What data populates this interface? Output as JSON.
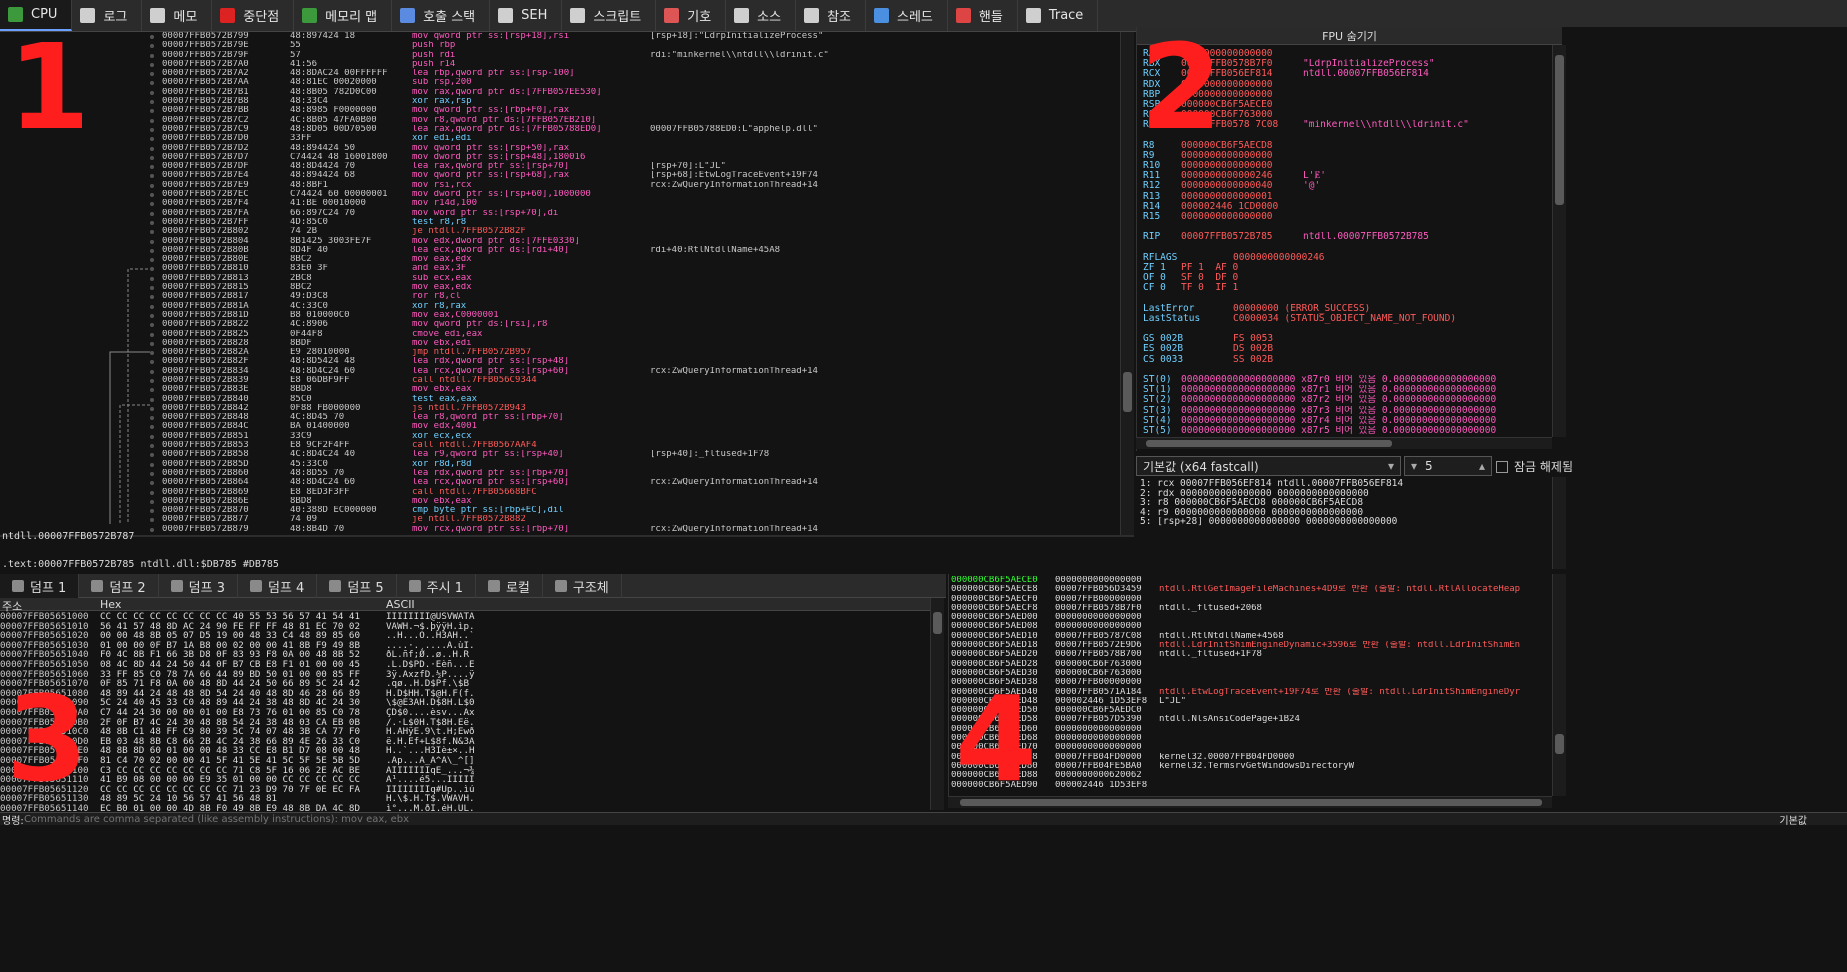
{
  "tabs": [
    {
      "label": "CPU",
      "icon": "cpu-icon",
      "color": "#3c9a3c"
    },
    {
      "label": "로그",
      "icon": "log-icon",
      "color": "#cfcfcf"
    },
    {
      "label": "메모",
      "icon": "notes-icon",
      "color": "#cfcfcf"
    },
    {
      "label": "중단점",
      "icon": "breakpoint-icon",
      "color": "#d22"
    },
    {
      "label": "메모리 맵",
      "icon": "memory-map-icon",
      "color": "#3c9a3c"
    },
    {
      "label": "호출 스택",
      "icon": "call-stack-icon",
      "color": "#5b8be0"
    },
    {
      "label": "SEH",
      "icon": "seh-icon",
      "color": "#cfcfcf"
    },
    {
      "label": "스크립트",
      "icon": "script-icon",
      "color": "#cfcfcf"
    },
    {
      "label": "기호",
      "icon": "symbols-icon",
      "color": "#d55"
    },
    {
      "label": "소스",
      "icon": "source-icon",
      "color": "#cfcfcf"
    },
    {
      "label": "참조",
      "icon": "references-icon",
      "color": "#cfcfcf"
    },
    {
      "label": "스레드",
      "icon": "threads-icon",
      "color": "#4a8fe0"
    },
    {
      "label": "핸들",
      "icon": "handles-icon",
      "color": "#d44"
    },
    {
      "label": "Trace",
      "icon": "trace-icon",
      "color": "#cfcfcf"
    }
  ],
  "disasm": [
    [
      "00007FFB0572B799",
      "48:897424 18",
      "mov qword ptr ss:[rsp+18],rsi",
      "[rsp+18]:\"LdrpInitializeProcess\""
    ],
    [
      "00007FFB0572B79E",
      "55",
      "push rbp",
      ""
    ],
    [
      "00007FFB0572B79F",
      "57",
      "push rdi",
      "rdi:\"minkernel\\\\ntdll\\\\ldrinit.c\""
    ],
    [
      "00007FFB0572B7A0",
      "41:56",
      "push r14",
      ""
    ],
    [
      "00007FFB0572B7A2",
      "48:8DAC24 00FFFFFF",
      "lea rbp,qword ptr ss:[rsp-100]",
      ""
    ],
    [
      "00007FFB0572B7AA",
      "48:81EC 00020000",
      "sub rsp,200",
      ""
    ],
    [
      "00007FFB0572B7B1",
      "48:8B05 782D0C00",
      "mov rax,qword ptr ds:[7FFB057EE530]",
      ""
    ],
    [
      "00007FFB0572B7B8",
      "48:33C4",
      "xor rax,rsp",
      ""
    ],
    [
      "00007FFB0572B7BB",
      "48:8985 F0000000",
      "mov qword ptr ss:[rbp+F0],rax",
      ""
    ],
    [
      "00007FFB0572B7C2",
      "4C:8B05 47FA0B00",
      "mov r8,qword ptr ds:[7FFB057EB210]",
      ""
    ],
    [
      "00007FFB0572B7C9",
      "48:8D05 00D70500",
      "lea rax,qword ptr ds:[7FFB05788ED0]",
      "00007FFB05788ED0:L\"apphelp.dll\""
    ],
    [
      "00007FFB0572B7D0",
      "33FF",
      "xor edi,edi",
      ""
    ],
    [
      "00007FFB0572B7D2",
      "48:894424 50",
      "mov qword ptr ss:[rsp+50],rax",
      ""
    ],
    [
      "00007FFB0572B7D7",
      "C74424 48 16001800",
      "mov dword ptr ss:[rsp+48],180016",
      ""
    ],
    [
      "00007FFB0572B7DF",
      "48:8D4424 70",
      "lea rax,qword ptr ss:[rsp+70]",
      "[rsp+70]:L\"JL\""
    ],
    [
      "00007FFB0572B7E4",
      "48:894424 68",
      "mov qword ptr ss:[rsp+68],rax",
      "[rsp+68]:EtwLogTraceEvent+19F74"
    ],
    [
      "00007FFB0572B7E9",
      "48:8BF1",
      "mov rsi,rcx",
      "rcx:ZwQueryInformationThread+14"
    ],
    [
      "00007FFB0572B7EC",
      "C74424 60 00000001",
      "mov dword ptr ss:[rsp+60],1000000",
      ""
    ],
    [
      "00007FFB0572B7F4",
      "41:BE 00010000",
      "mov r14d,100",
      ""
    ],
    [
      "00007FFB0572B7FA",
      "66:897C24 70",
      "mov word ptr ss:[rsp+70],di",
      ""
    ],
    [
      "00007FFB0572B7FF",
      "4D:85C0",
      "test r8,r8",
      ""
    ],
    [
      "00007FFB0572B802",
      "74 2B",
      "je ntdll.7FFB0572B82F",
      ""
    ],
    [
      "00007FFB0572B804",
      "8B1425 3003FE7F",
      "mov edx,dword ptr ds:[7FFE0330]",
      ""
    ],
    [
      "00007FFB0572B80B",
      "8D4F 40",
      "lea ecx,qword ptr ds:[rdi+40]",
      "rdi+40:RtlNtdllName+45A8"
    ],
    [
      "00007FFB0572B80E",
      "8BC2",
      "mov eax,edx",
      ""
    ],
    [
      "00007FFB0572B810",
      "83E0 3F",
      "and eax,3F",
      ""
    ],
    [
      "00007FFB0572B813",
      "2BC8",
      "sub ecx,eax",
      ""
    ],
    [
      "00007FFB0572B815",
      "8BC2",
      "mov eax,edx",
      ""
    ],
    [
      "00007FFB0572B817",
      "49:D3C8",
      "ror r8,cl",
      ""
    ],
    [
      "00007FFB0572B81A",
      "4C:33C0",
      "xor r8,rax",
      ""
    ],
    [
      "00007FFB0572B81D",
      "B8 010000C0",
      "mov eax,C0000001",
      ""
    ],
    [
      "00007FFB0572B822",
      "4C:8906",
      "mov qword ptr ds:[rsi],r8",
      ""
    ],
    [
      "00007FFB0572B825",
      "0F44F8",
      "cmove edi,eax",
      ""
    ],
    [
      "00007FFB0572B828",
      "8BDF",
      "mov ebx,edi",
      ""
    ],
    [
      "00007FFB0572B82A",
      "E9 28010000",
      "jmp ntdll.7FFB0572B957",
      ""
    ],
    [
      "00007FFB0572B82F",
      "48:8D5424 48",
      "lea rdx,qword ptr ss:[rsp+48]",
      ""
    ],
    [
      "00007FFB0572B834",
      "48:8D4C24 60",
      "lea rcx,qword ptr ss:[rsp+60]",
      "rcx:ZwQueryInformationThread+14"
    ],
    [
      "00007FFB0572B839",
      "E8 06DBF9FF",
      "call ntdll.7FFB056C9344",
      ""
    ],
    [
      "00007FFB0572B83E",
      "8BD8",
      "mov ebx,eax",
      ""
    ],
    [
      "00007FFB0572B840",
      "85C0",
      "test eax,eax",
      ""
    ],
    [
      "00007FFB0572B842",
      "0F88 FB000000",
      "js ntdll.7FFB0572B943",
      ""
    ],
    [
      "00007FFB0572B848",
      "4C:8D45 70",
      "lea r8,qword ptr ss:[rbp+70]",
      ""
    ],
    [
      "00007FFB0572B84C",
      "BA 01400000",
      "mov edx,4001",
      ""
    ],
    [
      "00007FFB0572B851",
      "33C9",
      "xor ecx,ecx",
      ""
    ],
    [
      "00007FFB0572B853",
      "E8 9CF2F4FF",
      "call ntdll.7FFB0567AAF4",
      ""
    ],
    [
      "00007FFB0572B858",
      "4C:8D4C24 40",
      "lea r9,qword ptr ss:[rsp+40]",
      "[rsp+40]:_fltused+1F78"
    ],
    [
      "00007FFB0572B85D",
      "45:33C0",
      "xor r8d,r8d",
      ""
    ],
    [
      "00007FFB0572B860",
      "48:8D55 70",
      "lea rdx,qword ptr ss:[rbp+70]",
      ""
    ],
    [
      "00007FFB0572B864",
      "48:8D4C24 60",
      "lea rcx,qword ptr ss:[rsp+60]",
      "rcx:ZwQueryInformationThread+14"
    ],
    [
      "00007FFB0572B869",
      "E8 8ED3F3FF",
      "call ntdll.7FFB05668BFC",
      ""
    ],
    [
      "00007FFB0572B86E",
      "8BD8",
      "mov ebx,eax",
      ""
    ],
    [
      "00007FFB0572B870",
      "40:388D EC000000",
      "cmp byte ptr ss:[rbp+EC],dil",
      ""
    ],
    [
      "00007FFB0572B877",
      "74 09",
      "je ntdll.7FFB0572B882",
      ""
    ],
    [
      "00007FFB0572B879",
      "48:8B4D 70",
      "mov rcx,qword ptr ss:[rbp+70]",
      "rcx:ZwQueryInformationThread+14"
    ]
  ],
  "disasm_status": "ntdll.00007FFB0572B787",
  "disasm_status2": ".text:00007FFB0572B785 ntdll.dll:$DB785 #DB785",
  "fpu_toggle": "FPU 숨기기",
  "registers": [
    [
      "RAX",
      "0000000000000000",
      ""
    ],
    [
      "RBX",
      "00007FFB0578B7F0",
      "\"LdrpInitializeProcess\""
    ],
    [
      "RCX",
      "00007FFB056EF814",
      "ntdll.00007FFB056EF814"
    ],
    [
      "RDX",
      "0000000000000000",
      ""
    ],
    [
      "RBP",
      "0000000000000000",
      ""
    ],
    [
      "RSP",
      "000000CB6F5AECE0",
      ""
    ],
    [
      "RSI",
      "000000CB6F763000",
      ""
    ],
    [
      "RDI",
      "00007FFB0578 7C08",
      "\"minkernel\\\\ntdll\\\\ldrinit.c\""
    ],
    [
      "",
      ""
    ],
    [
      "R8",
      "000000CB6F5AECD8",
      ""
    ],
    [
      "R9",
      "0000000000000000",
      ""
    ],
    [
      "R10",
      "0000000000000000",
      ""
    ],
    [
      "R11",
      "0000000000000246",
      "L'Ɇ'"
    ],
    [
      "R12",
      "0000000000000040",
      "'@'"
    ],
    [
      "R13",
      "0000000000000001",
      ""
    ],
    [
      "R14",
      "000002446 1CD0000",
      ""
    ],
    [
      "R15",
      "0000000000000000",
      ""
    ],
    [
      "",
      ""
    ],
    [
      "RIP",
      "00007FFB0572B785",
      "ntdll.00007FFB0572B785"
    ],
    [
      "",
      ""
    ],
    [
      "RFLAGS",
      "0000000000000246",
      ""
    ],
    [
      "ZF 1",
      "PF 1  AF 0",
      ""
    ],
    [
      "OF 0",
      "SF 0  DF 0",
      ""
    ],
    [
      "CF 0",
      "TF 0  IF 1",
      ""
    ],
    [
      "",
      ""
    ],
    [
      "LastError",
      "00000000 (ERROR_SUCCESS)",
      ""
    ],
    [
      "LastStatus",
      "C0000034 (STATUS_OBJECT_NAME_NOT_FOUND)",
      ""
    ],
    [
      "",
      ""
    ],
    [
      "GS 002B",
      "FS 0053",
      ""
    ],
    [
      "ES 002B",
      "DS 002B",
      ""
    ],
    [
      "CS 0033",
      "SS 002B",
      ""
    ],
    [
      "",
      ""
    ],
    [
      "ST(0)",
      "00000000000000000000 x87r0 비어 있음 0.000000000000000000",
      ""
    ],
    [
      "ST(1)",
      "00000000000000000000 x87r1 비어 있음 0.000000000000000000",
      ""
    ],
    [
      "ST(2)",
      "00000000000000000000 x87r2 비어 있음 0.000000000000000000",
      ""
    ],
    [
      "ST(3)",
      "00000000000000000000 x87r3 비어 있음 0.000000000000000000",
      ""
    ],
    [
      "ST(4)",
      "00000000000000000000 x87r4 비어 있음 0.000000000000000000",
      ""
    ],
    [
      "ST(5)",
      "00000000000000000000 x87r5 비어 있음 0.000000000000000000",
      ""
    ]
  ],
  "callconv": "기본값 (x64 fastcall)",
  "argcount": "5",
  "lock_label": "잠금 해제됨",
  "args": [
    "1: rcx 00007FFB056EF814 ntdll.00007FFB056EF814",
    "2: rdx 0000000000000000 0000000000000000",
    "3: r8 000000CB6F5AECD8 000000CB6F5AECD8",
    "4: r9 0000000000000000 0000000000000000",
    "5: [rsp+28] 0000000000000000 0000000000000000"
  ],
  "dump_tabs": [
    {
      "label": "덤프 1",
      "icon": "dump-icon"
    },
    {
      "label": "덤프 2",
      "icon": "dump-icon"
    },
    {
      "label": "덤프 3",
      "icon": "dump-icon"
    },
    {
      "label": "덤프 4",
      "icon": "dump-icon"
    },
    {
      "label": "덤프 5",
      "icon": "dump-icon"
    },
    {
      "label": "주시 1",
      "icon": "watch-icon"
    },
    {
      "label": "로컬",
      "icon": "locals-icon"
    },
    {
      "label": "구조체",
      "icon": "struct-icon"
    }
  ],
  "dump_headers": [
    "주소",
    "Hex",
    "ASCII"
  ],
  "dump_rows": [
    [
      "00007FFB05651000",
      "CC CC CC CC CC CC CC CC 40 55 53 56 57 41 54 41",
      "ÌÌÌÌÌÌÌÌ@USVWATA"
    ],
    [
      "00007FFB05651010",
      "56 41 57 48 8D AC 24 90 FE FF FF 48 81 EC 70 02",
      "VAWH.¬$.þÿÿH.ìp."
    ],
    [
      "00007FFB05651020",
      "00 00 48 8B 05 07 D5 19 00 48 33 C4 48 89 85 60",
      "..H...Õ..H3ÄH..`"
    ],
    [
      "00007FFB05651030",
      "01 00 00 0F B7 1A B8 00 02 00 00 41 8B F9 49 8B",
      "....·.¸....A.ùI."
    ],
    [
      "00007FFB05651040",
      "F0 4C 8B F1 66 3B D8 0F 83 93 F8 0A 00 48 8B 52",
      "ðL.ñf;Ø..ø..H.R"
    ],
    [
      "00007FFB05651050",
      "08 4C 8D 44 24 50 44 0F B7 CB E8 F1 01 00 00 45",
      ".L.D$PD.·Ëèñ...E"
    ],
    [
      "00007FFB05651060",
      "33 FF 85 C0 78 7A 66 44 89 BD 50 01 00 00 85 FF",
      "3ÿ.ÀxzfD.½P....ÿ"
    ],
    [
      "00007FFB05651070",
      "0F 85 71 F8 0A 00 48 8D 44 24 50 66 89 5C 24 42",
      ".qø..H.D$Pf.\\$B"
    ],
    [
      "00007FFB05651080",
      "48 89 44 24 48 48 8D 54 24 40 48 8D 46 28 66 89",
      "H.D$HH.T$@H.F(f."
    ],
    [
      "00007FFB05651090",
      "5C 24 40 45 33 C0 48 89 44 24 38 48 8D 4C 24 30",
      "\\$@E3ÀH.D$8H.L$0"
    ],
    [
      "00007FFB056510A0",
      "C7 44 24 30 00 00 01 00 E8 73 76 01 00 85 C0 78",
      "ÇD$0....èsv...Àx"
    ],
    [
      "00007FFB056510B0",
      "2F 0F B7 4C 24 30 48 8B 54 24 38 48 03 CA EB 0B",
      "/.·L$0H.T$8H.Êë."
    ],
    [
      "00007FFB056510C0",
      "48 8B C1 48 FF C9 80 39 5C 74 07 48 3B CA 77 F0",
      "H.ÁHÿÉ.9\\t.H;Êwð"
    ],
    [
      "00007FFB056510D0",
      "EB 03 48 8B C8 66 2B 4C 24 38 66 89 4E 26 33 C0",
      "ë.H.Èf+L$8f.N&3À"
    ],
    [
      "00007FFB056510E0",
      "48 8B 8D 60 01 00 00 48 33 CC E8 B1 D7 08 00 48",
      "H..`...H3Ìè±×..H"
    ],
    [
      "00007FFB056510F0",
      "81 C4 70 02 00 00 41 5F 41 5E 41 5C 5F 5E 5B 5D",
      ".Äp...A_A^A\\_^[]"
    ],
    [
      "00007FFB05651100",
      "C3 CC CC CC CC CC CC CC 71 C8 5F 16 06 2E AC BE",
      "ÃÌÌÌÌÌÌÌqÈ_...¬¾"
    ],
    [
      "00007FFB05651110",
      "41 B9 08 00 00 00 E9 35 01 00 00 CC CC CC CC CC",
      "A¹....é5...ÌÌÌÌÌ"
    ],
    [
      "00007FFB05651120",
      "CC CC CC CC CC CC CC CC 71 23 D9 70 7F 0E EC FA",
      "ÌÌÌÌÌÌÌÌq#Ùp..ìú"
    ],
    [
      "00007FFB05651130",
      "48 89 5C 24 10 56 57 41 56 48 81",
      "H.\\$.H.T$.VWAVH."
    ],
    [
      "00007FFB05651140",
      "EC B0 01 00 00 4D 8B F0 49 8B E9 48 8B DA 4C 8D",
      "ì°...M.ðI.éH.ÚL."
    ]
  ],
  "stack_rows": [
    [
      "000000CB6F5AECE0",
      "0000000000000000",
      ""
    ],
    [
      "000000CB6F5AECE8",
      "00007FFB056D3459",
      "ntdll.RtlGetImageFileMachines+4D9로 반환 (출발: ntdll.RtlAllocateHeap"
    ],
    [
      "000000CB6F5AECF0",
      "00007FFB00000000",
      ""
    ],
    [
      "000000CB6F5AECF8",
      "00007FFB0578B7F0",
      "ntdll._fltused+2068"
    ],
    [
      "000000CB6F5AED00",
      "0000000000000000",
      ""
    ],
    [
      "000000CB6F5AED08",
      "0000000000000000",
      ""
    ],
    [
      "000000CB6F5AED10",
      "00007FFB05787C08",
      "ntdll.RtlNtdllName+4568"
    ],
    [
      "000000CB6F5AED18",
      "00007FFB0572E9D6",
      "ntdll.LdrInitShimEngineDynamic+3596로 반환 (출발: ntdll.LdrInitShimEn"
    ],
    [
      "000000CB6F5AED20",
      "00007FFB0578B700",
      "ntdll._fltused+1F78"
    ],
    [
      "000000CB6F5AED28",
      "000000CB6F763000",
      ""
    ],
    [
      "000000CB6F5AED30",
      "000000CB6F763000",
      ""
    ],
    [
      "000000CB6F5AED38",
      "00007FFB00000000",
      ""
    ],
    [
      "000000CB6F5AED40",
      "00007FFB0571A184",
      "ntdll.EtwLogTraceEvent+19F74로 반환 (출발: ntdll.LdrInitShimEngineDyr"
    ],
    [
      "000000CB6F5AED48",
      "000002446 1D53EF8",
      "L\"JL\""
    ],
    [
      "000000CB6F5AED50",
      "000000CB6F5AEDC0",
      ""
    ],
    [
      "000000CB6F5AED58",
      "00007FFB057D5390",
      "ntdll.NlsAnsiCodePage+1B24"
    ],
    [
      "000000CB6F5AED60",
      "0000000000000000",
      ""
    ],
    [
      "000000CB6F5AED68",
      "0000000000000000",
      ""
    ],
    [
      "000000CB6F5AED70",
      "0000000000000000",
      ""
    ],
    [
      "000000CB6F5AED78",
      "00007FFB04FD0000",
      "kernel32.00007FFB04FD0000"
    ],
    [
      "000000CB6F5AED80",
      "00007FFB04FE5BA0",
      "kernel32.TermsrvGetWindowsDirectoryW"
    ],
    [
      "000000CB6F5AED88",
      "0000000000620062",
      ""
    ],
    [
      "000000CB6F5AED90",
      "000002446 1D53EF8",
      ""
    ]
  ],
  "command_label": "명령:",
  "command_placeholder": "Commands are comma separated (like assembly instructions): mov eax, ebx",
  "status_right": "기본값",
  "region_labels": [
    "1",
    "2",
    "3",
    "4"
  ],
  "colors": {
    "bg": "#131313",
    "accent_red": "#ff1e1e",
    "text_red": "#ff5a5a",
    "text_magenta": "#ff5abf",
    "text_cyan": "#6fd0ff"
  }
}
